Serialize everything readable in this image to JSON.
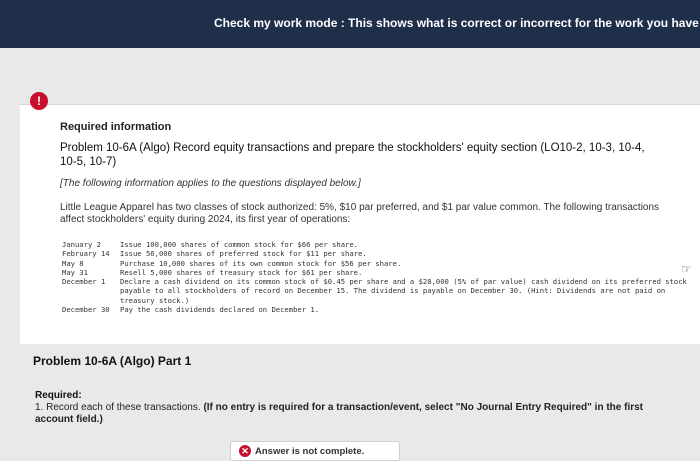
{
  "banner": {
    "text": "Check my work mode : This shows what is correct or incorrect for the work you have complete"
  },
  "alert": {
    "glyph": "!"
  },
  "required_info": "Required information",
  "problem": {
    "title": "Problem 10-6A (Algo) Record equity transactions and prepare the stockholders' equity section (LO10-2, 10-3, 10-4, 10-5, 10-7)",
    "applies_note": "[The following information applies to the questions displayed below.]",
    "intro": "Little League Apparel has two classes of stock authorized: 5%, $10 par preferred, and $1 par value common. The following transactions affect stockholders' equity during 2024, its first year of operations:"
  },
  "transactions": [
    {
      "date": "January 2",
      "desc": "Issue 100,000 shares of common stock for $66 per share."
    },
    {
      "date": "February 14",
      "desc": "Issue 56,000 shares of preferred stock for $11 per share."
    },
    {
      "date": "May 8",
      "desc": "Purchase 10,000 shares of its own common stock for $56 per share."
    },
    {
      "date": "May 31",
      "desc": "Resell 5,000 shares of treasury stock for $61 per share."
    },
    {
      "date": "December 1",
      "desc": "Declare a cash dividend on its common stock of $0.45 per share and a $28,000 (5% of par value) cash dividend on its preferred stock payable to all stockholders of record on December 15. The dividend is payable on December 30. (Hint: Dividends are not paid on treasury stock.)"
    },
    {
      "date": "December 30",
      "desc": "Pay the cash dividends declared on December 1."
    }
  ],
  "part": {
    "title": "Problem 10-6A (Algo) Part 1",
    "required_label": "Required:",
    "instruction_plain": "1. Record each of these transactions. ",
    "instruction_bold": "(If no entry is required for a transaction/event, select \"No Journal Entry Required\" in the first account field.)"
  },
  "status": {
    "text": "Answer is not complete."
  }
}
